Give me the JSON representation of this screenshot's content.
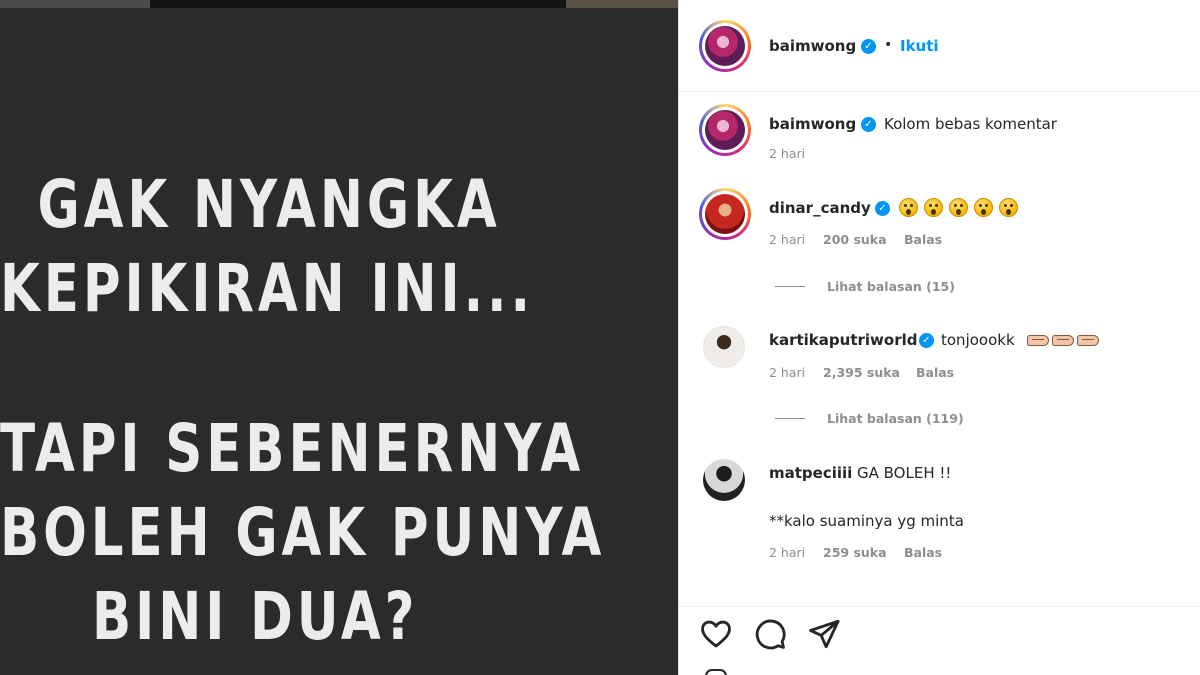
{
  "post_image": {
    "lines": [
      "GAK NYANGKA",
      "KEPIKIRAN INI...",
      "TAPI SEBENERNYA",
      "BOLEH GAK PUNYA",
      "BINI DUA?"
    ]
  },
  "header": {
    "username": "baimwong",
    "separator": "•",
    "follow_label": "Ikuti",
    "avatar_icon": "profile-avatar-icon",
    "verified_icon": "verified-badge-icon"
  },
  "caption": {
    "username": "baimwong",
    "text": "Kolom bebas komentar",
    "time": "2 hari"
  },
  "comments": [
    {
      "username": "dinar_candy",
      "emoji": "astonished-face-emoji",
      "emoji_count": 5,
      "time": "2 hari",
      "likes": "200 suka",
      "reply_label": "Balas",
      "view_replies": "Lihat balasan (15)"
    },
    {
      "username": "kartikaputriworld",
      "text": "tonjoookk",
      "emoji": "oncoming-fist-emoji",
      "emoji_count": 3,
      "time": "2 hari",
      "likes": "2,395 suka",
      "reply_label": "Balas",
      "view_replies": "Lihat balasan (119)"
    },
    {
      "username": "matpeciiii",
      "text": "GA BOLEH !!",
      "text2": "**kalo suaminya yg minta",
      "time": "2 hari",
      "likes": "259 suka",
      "reply_label": "Balas"
    }
  ],
  "actions": {
    "like_icon": "heart-icon",
    "comment_icon": "comment-icon",
    "share_icon": "send-icon"
  },
  "colors": {
    "accent": "#0095f6",
    "image_bg": "#2b2b2b",
    "image_text": "#ececec",
    "meta_text": "#8e8e8e"
  }
}
